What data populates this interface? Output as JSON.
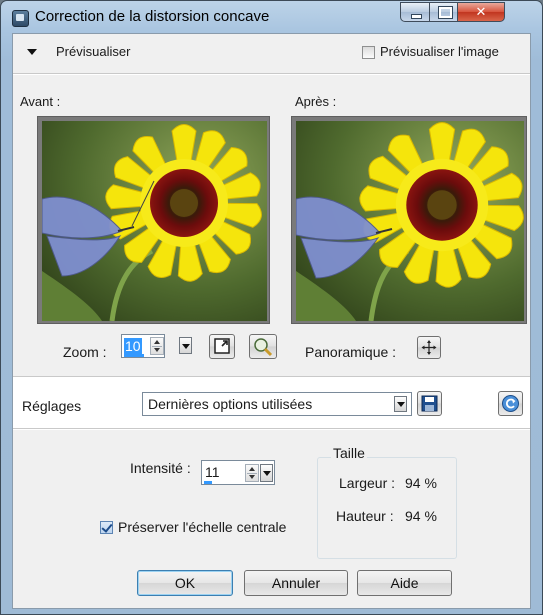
{
  "window": {
    "title": "Correction de la distorsion concave"
  },
  "preview": {
    "toggle_label": "Prévisualiser",
    "preview_image_label": "Prévisualiser l'image",
    "preview_image_checked": false,
    "before_label": "Avant :",
    "after_label": "Après :"
  },
  "zoom": {
    "label": "Zoom :",
    "value": "10",
    "pan_label": "Panoramique :"
  },
  "presets": {
    "label": "Réglages",
    "selected": "Dernières options utilisées"
  },
  "settings": {
    "intensity_label": "Intensité :",
    "intensity_value": "11",
    "size_group_label": "Taille",
    "width_label": "Largeur :",
    "width_value": "94 %",
    "height_label": "Hauteur :",
    "height_value": "94 %",
    "preserve_scale_label": "Préserver l'échelle centrale",
    "preserve_scale_checked": true
  },
  "buttons": {
    "ok": "OK",
    "cancel": "Annuler",
    "help": "Aide"
  }
}
